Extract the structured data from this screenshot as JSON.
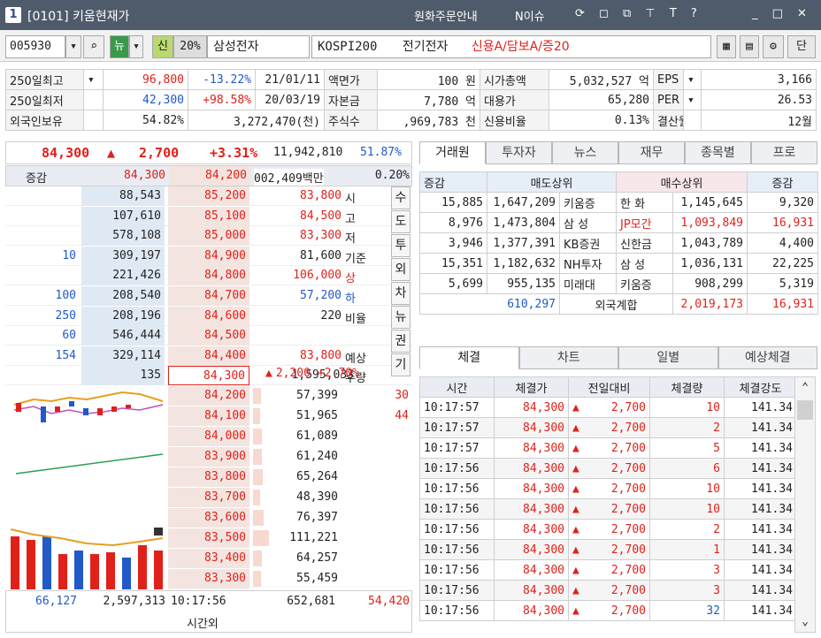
{
  "window": {
    "num": "1",
    "title": "[0101] 키움현재가",
    "links": [
      "원화주문안내",
      "N이슈"
    ],
    "controls": [
      "minimize",
      "maximize",
      "close"
    ]
  },
  "toolbar": {
    "code": "005930",
    "news": "뉴",
    "credit": "신",
    "margin": "20%",
    "name": "삼성전자",
    "market": "KOSPI200",
    "sector": "전기전자",
    "tags": "신용A/담보A/증20",
    "btn": "단"
  },
  "info": {
    "rows": [
      [
        "250일최고",
        "96,800",
        "-13.22%",
        "21/01/11",
        "액면가",
        "100 원",
        "시가총액",
        "5,032,527 억",
        "EPS",
        "3,166"
      ],
      [
        "250일최저",
        "42,300",
        "+98.58%",
        "20/03/19",
        "자본금",
        "7,780 억",
        "대용가",
        "65,280",
        "PER",
        "26.53"
      ],
      [
        "외국인보유",
        "54.82%",
        "3,272,470(천)",
        "",
        "주식수",
        ",969,783 천",
        "신용비율",
        "0.13%",
        "결산월",
        "12월"
      ]
    ]
  },
  "price": {
    "cur": "84,300",
    "arrow": "▲",
    "chg": "2,700",
    "pct": "+3.31%",
    "vol": "11,942,810",
    "ratio": "51.87%"
  },
  "orderbook": {
    "hdr": [
      "증감",
      "84,300",
      "84,200",
      "002,409백만",
      "0.20%"
    ],
    "asks": [
      [
        "",
        "88,543",
        "85,200"
      ],
      [
        "",
        "107,610",
        "85,100"
      ],
      [
        "",
        "578,108",
        "85,000"
      ],
      [
        "10",
        "309,197",
        "84,900"
      ],
      [
        "",
        "221,426",
        "84,800"
      ],
      [
        "100",
        "208,540",
        "84,700"
      ],
      [
        "250",
        "208,196",
        "84,600"
      ],
      [
        "60",
        "546,444",
        "84,500"
      ],
      [
        "154",
        "329,114",
        "84,400"
      ],
      [
        "",
        "135",
        "84,300"
      ]
    ],
    "info": [
      [
        "83,800",
        "시"
      ],
      [
        "84,500",
        "고"
      ],
      [
        "83,300",
        "저"
      ],
      [
        "81,600",
        "기준"
      ],
      [
        "106,000",
        "상"
      ],
      [
        "57,200",
        "하"
      ],
      [
        "220",
        "비율"
      ],
      [
        "",
        ""
      ],
      [
        "83,800",
        "예상"
      ],
      [
        "1,595,033",
        "수량"
      ]
    ],
    "exp": {
      "arrow": "▲",
      "chg": "2,200",
      "pct": "+2.70%"
    },
    "sidebtns": [
      "수",
      "도",
      "투",
      "외",
      "차",
      "뉴",
      "권",
      "기"
    ],
    "bids": [
      [
        "84,200",
        "57,399",
        "30"
      ],
      [
        "84,100",
        "51,965",
        "44"
      ],
      [
        "84,000",
        "61,089",
        ""
      ],
      [
        "83,900",
        "61,240",
        ""
      ],
      [
        "83,800",
        "65,264",
        ""
      ],
      [
        "83,700",
        "48,390",
        ""
      ],
      [
        "83,600",
        "76,397",
        ""
      ],
      [
        "83,500",
        "111,221",
        ""
      ],
      [
        "83,400",
        "64,257",
        ""
      ],
      [
        "83,300",
        "55,459",
        ""
      ]
    ],
    "footer": [
      "66,127",
      "2,597,313",
      "10:17:56",
      "652,681",
      "54,420"
    ],
    "footer_sub": "시간외"
  },
  "topTabs": [
    "거래원",
    "투자자",
    "뉴스",
    "재무",
    "종목별",
    "프로"
  ],
  "brokers": {
    "hdr": [
      "증감",
      "매도상위",
      "매수상위",
      "증감"
    ],
    "rows": [
      [
        "15,885",
        "1,647,209",
        "키움증",
        "한  화",
        "1,145,645",
        "9,320"
      ],
      [
        "8,976",
        "1,473,804",
        "삼  성",
        "JP모간",
        "1,093,849",
        "16,931"
      ],
      [
        "3,946",
        "1,377,391",
        "KB증권",
        "신한금",
        "1,043,789",
        "4,400"
      ],
      [
        "15,351",
        "1,182,632",
        "NH투자",
        "삼  성",
        "1,036,131",
        "22,225"
      ],
      [
        "5,699",
        "955,135",
        "미래대",
        "키움증",
        "908,299",
        "5,319"
      ]
    ],
    "foreign": [
      "610,297",
      "외국계합",
      "2,019,173",
      "16,931"
    ]
  },
  "botTabs": [
    "체결",
    "차트",
    "일별",
    "예상체결"
  ],
  "trades": {
    "hdr": [
      "시간",
      "체결가",
      "전일대비",
      "체결량",
      "체결강도"
    ],
    "rows": [
      [
        "10:17:57",
        "84,300",
        "▲",
        "2,700",
        "10",
        "141.34"
      ],
      [
        "10:17:57",
        "84,300",
        "▲",
        "2,700",
        "2",
        "141.34"
      ],
      [
        "10:17:57",
        "84,300",
        "▲",
        "2,700",
        "5",
        "141.34"
      ],
      [
        "10:17:56",
        "84,300",
        "▲",
        "2,700",
        "6",
        "141.34"
      ],
      [
        "10:17:56",
        "84,300",
        "▲",
        "2,700",
        "10",
        "141.34"
      ],
      [
        "10:17:56",
        "84,300",
        "▲",
        "2,700",
        "10",
        "141.34"
      ],
      [
        "10:17:56",
        "84,300",
        "▲",
        "2,700",
        "2",
        "141.34"
      ],
      [
        "10:17:56",
        "84,300",
        "▲",
        "2,700",
        "1",
        "141.34"
      ],
      [
        "10:17:56",
        "84,300",
        "▲",
        "2,700",
        "3",
        "141.34"
      ],
      [
        "10:17:56",
        "84,300",
        "▲",
        "2,700",
        "3",
        "141.34"
      ],
      [
        "10:17:56",
        "84,300",
        "▲",
        "2,700",
        "32",
        "141.34"
      ]
    ]
  },
  "colors": {
    "up": "#e0211a",
    "down": "#2159c8",
    "titlebar": "#4f5b6a"
  }
}
